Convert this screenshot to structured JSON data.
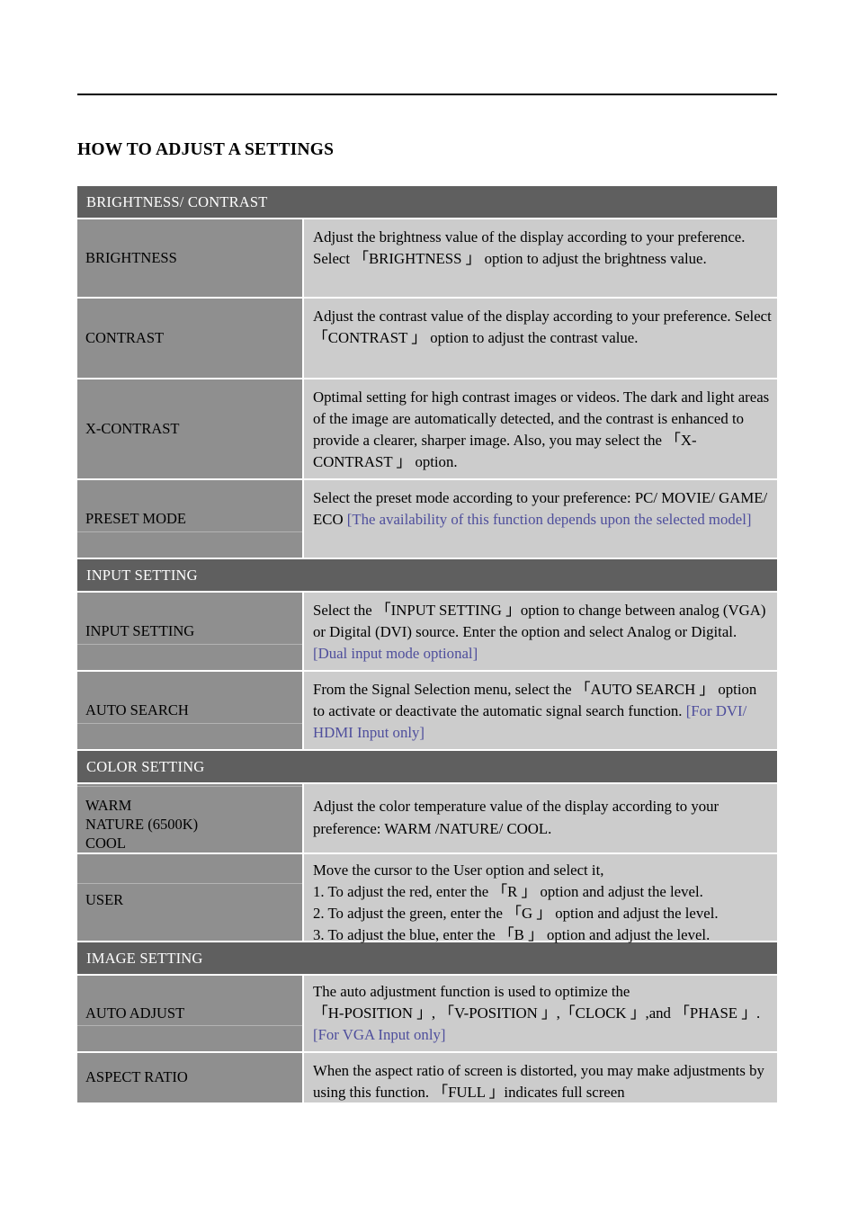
{
  "document": {
    "title": "HOW TO ADJUST A SETTINGS"
  },
  "table": {
    "sections": [
      {
        "band": "BRIGHTNESS/ CONTRAST",
        "rows": [
          {
            "label": "BRIGHTNESS",
            "desc_pre": "Adjust the brightness value of the display according to your preference. Select 「BRIGHTNESS 」 option to adjust the brightness value.",
            "desc_note": ""
          },
          {
            "label": "CONTRAST",
            "desc_pre": "Adjust the contrast value of the display according to your preference. Select 「CONTRAST 」 option to adjust the contrast value.",
            "desc_note": ""
          },
          {
            "label": "X-CONTRAST",
            "desc_pre": "Optimal setting for high contrast images or videos. The dark and light areas of the image are automatically detected, and the contrast is enhanced to provide a clearer, sharper image. Also, you may select the 「X-CONTRAST 」 option.",
            "desc_note": ""
          },
          {
            "label": "PRESET MODE",
            "desc_pre": "Select the preset mode according to your preference: PC/ MOVIE/ GAME/ ECO ",
            "desc_note": "[The availability of this function depends upon the selected model]"
          }
        ]
      },
      {
        "band": "INPUT SETTING",
        "rows": [
          {
            "label": "INPUT SETTING",
            "desc_pre": "Select the 「INPUT SETTING 」option to change between analog (VGA) or Digital (DVI) source. Enter the option and select Analog or Digital. ",
            "desc_note": "[Dual input mode optional]"
          },
          {
            "label": "AUTO SEARCH",
            "desc_pre": "From the Signal Selection menu, select the 「AUTO SEARCH 」 option to activate or deactivate the automatic signal search function. ",
            "desc_note": "[For DVI/ HDMI Input only]"
          }
        ]
      },
      {
        "band": "COLOR SETTING",
        "rows": [
          {
            "label_lines": [
              "WARM",
              "NATURE (6500K)",
              "COOL"
            ],
            "desc_pre": "Adjust the color temperature value of the display according to your preference: WARM /NATURE/ COOL.",
            "desc_note": ""
          },
          {
            "label": "USER",
            "desc_lines": [
              "Move the cursor to the User option and select it,",
              "1. To adjust the red, enter the 「R 」 option and adjust the level.",
              "2. To adjust the green, enter the 「G 」 option and adjust the level.",
              "3. To adjust the blue, enter the 「B 」 option and adjust the level."
            ],
            "desc_note": ""
          }
        ]
      },
      {
        "band": "IMAGE SETTING",
        "rows": [
          {
            "label": "AUTO ADJUST",
            "desc_lines": [
              "The auto adjustment function is used to optimize the",
              "「H-POSITION 」, 「V-POSITION 」,「CLOCK 」,and 「PHASE 」."
            ],
            "desc_note": "[For VGA Input only]"
          },
          {
            "label": "ASPECT RATIO",
            "desc_pre": "When the aspect ratio of screen is distorted, you may make adjustments by using this function. 「FULL 」indicates full screen",
            "desc_note": ""
          }
        ]
      }
    ]
  },
  "colors": {
    "section_band": "#5f5f5f",
    "label_cell": "#8f8f8f",
    "desc_cell": "#cccccc",
    "note_text": "#4e4e9c",
    "page_background": "#ffffff",
    "body_text": "#000000"
  }
}
